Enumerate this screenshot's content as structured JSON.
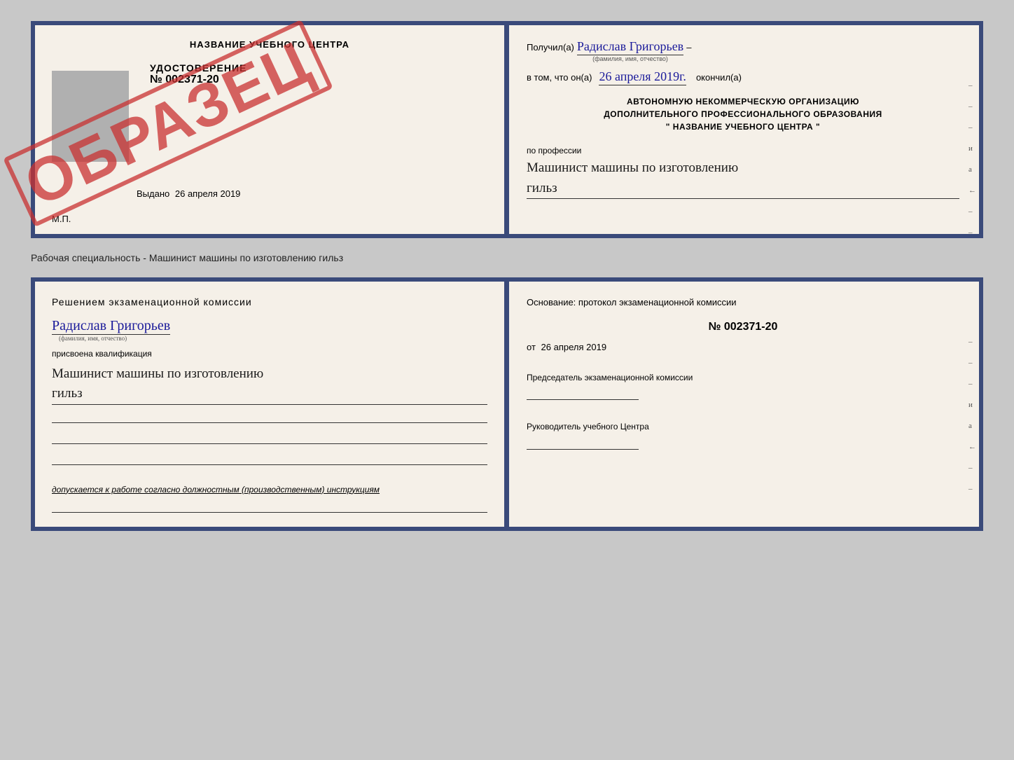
{
  "top_doc": {
    "left": {
      "title": "НАЗВАНИЕ УЧЕБНОГО ЦЕНТРА",
      "cert_label": "УДОСТОВЕРЕНИЕ",
      "cert_number": "№ 002371-20",
      "stamp": "ОБРАЗЕЦ",
      "vydano_label": "Выдано",
      "vydano_date": "26 апреля 2019",
      "mp": "М.П."
    },
    "right": {
      "received_label": "Получил(а)",
      "name_handwritten": "Радислав Григорьев",
      "name_subtext": "(фамилия, имя, отчество)",
      "in_that_label": "в том, что он(а)",
      "date_handwritten": "26 апреля 2019г.",
      "finished_label": "окончил(а)",
      "org_line1": "АВТОНОМНУЮ НЕКОММЕРЧЕСКУЮ ОРГАНИЗАЦИЮ",
      "org_line2": "ДОПОЛНИТЕЛЬНОГО ПРОФЕССИОНАЛЬНОГО ОБРАЗОВАНИЯ",
      "org_line3": "\"  НАЗВАНИЕ УЧЕБНОГО ЦЕНТРА  \"",
      "profession_label": "по профессии",
      "profession_handwritten_line1": "Машинист машины по изготовлению",
      "profession_handwritten_line2": "гильз",
      "side_marks": [
        "–",
        "–",
        "–",
        "и",
        "а",
        "←",
        "–",
        "–"
      ]
    }
  },
  "middle_label": "Рабочая специальность - Машинист машины по изготовлению гильз",
  "bottom_doc": {
    "left": {
      "heading": "Решением  экзаменационной  комиссии",
      "name_handwritten": "Радислав Григорьев",
      "name_subtext": "(фамилия, имя, отчество)",
      "assigned_label": "присвоена квалификация",
      "qualification_line1": "Машинист машины по изготовлению",
      "qualification_line2": "гильз",
      "dopusk_text": "допускается к  работе согласно должностным (производственным) инструкциям"
    },
    "right": {
      "basis_label": "Основание: протокол экзаменационной  комиссии",
      "protocol_number": "№  002371-20",
      "protocol_date_prefix": "от",
      "protocol_date": "26 апреля 2019",
      "chairman_label": "Председатель экзаменационной комиссии",
      "director_label": "Руководитель учебного Центра",
      "side_marks": [
        "–",
        "–",
        "–",
        "и",
        "а",
        "←",
        "–",
        "–"
      ]
    }
  }
}
